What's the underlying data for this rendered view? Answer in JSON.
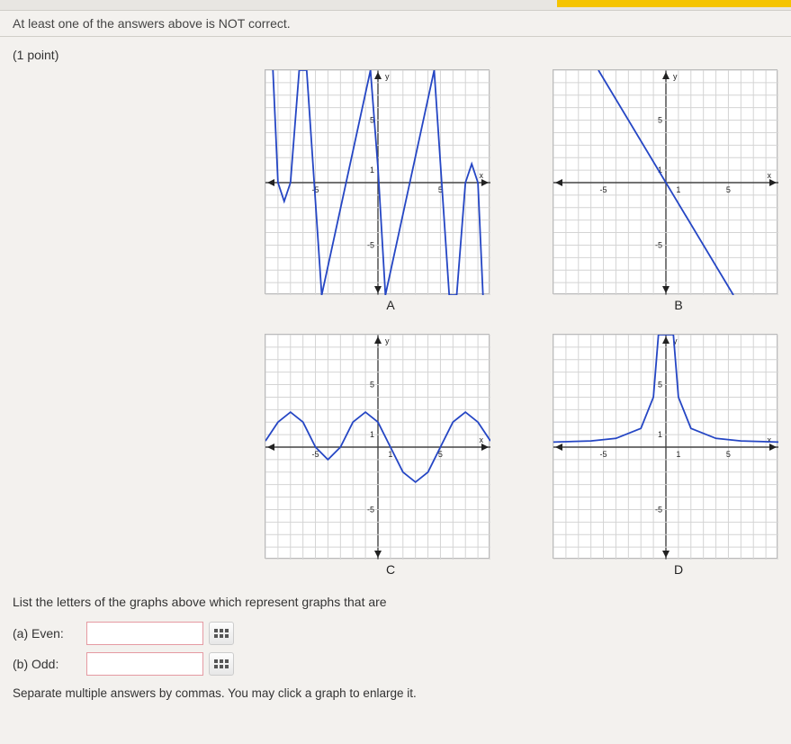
{
  "feedback": "At least one of the answers above is NOT correct.",
  "points": "(1 point)",
  "graphs": {
    "A": {
      "label": "A"
    },
    "B": {
      "label": "B"
    },
    "C": {
      "label": "C"
    },
    "D": {
      "label": "D"
    }
  },
  "prompt": "List the letters of the graphs above which represent graphs that are",
  "answers": {
    "even": {
      "label": "(a) Even:",
      "value": ""
    },
    "odd": {
      "label": "(b) Odd:",
      "value": ""
    }
  },
  "hint": "Separate multiple answers by commas. You may click a graph to enlarge it.",
  "chart_data": [
    {
      "id": "A",
      "type": "line",
      "xlabel": "x",
      "ylabel": "y",
      "xlim": [
        -9,
        9
      ],
      "ylim": [
        -9,
        9
      ],
      "grid": true,
      "ticks": {
        "x": [
          -5,
          5
        ],
        "y": [
          -5,
          1,
          5
        ]
      },
      "description": "odd-symmetric curve (origin symmetry)",
      "points": [
        [
          -8.4,
          9
        ],
        [
          -8,
          0
        ],
        [
          -7.5,
          -1.5
        ],
        [
          -7,
          0
        ],
        [
          -6.3,
          9
        ],
        [
          -5.7,
          9
        ],
        [
          -4.5,
          -9
        ],
        [
          -0.6,
          9
        ],
        [
          0,
          1.2
        ],
        [
          0.6,
          -9
        ],
        [
          4.5,
          9
        ],
        [
          5.7,
          -9
        ],
        [
          6.3,
          -9
        ],
        [
          7,
          0
        ],
        [
          7.5,
          1.5
        ],
        [
          8,
          0
        ],
        [
          8.4,
          -9
        ]
      ]
    },
    {
      "id": "B",
      "type": "line",
      "xlabel": "x",
      "ylabel": "y",
      "xlim": [
        -9,
        9
      ],
      "ylim": [
        -9,
        9
      ],
      "grid": true,
      "ticks": {
        "x": [
          -5,
          1,
          5
        ],
        "y": [
          -5,
          1,
          5
        ]
      },
      "description": "straight line through origin, negative slope (odd)",
      "points": [
        [
          -5.4,
          9
        ],
        [
          5.4,
          -9
        ]
      ]
    },
    {
      "id": "C",
      "type": "line",
      "xlabel": "x",
      "ylabel": "y",
      "xlim": [
        -9,
        9
      ],
      "ylim": [
        -9,
        9
      ],
      "grid": true,
      "ticks": {
        "x": [
          -5,
          1,
          5
        ],
        "y": [
          -5,
          1,
          5
        ]
      },
      "description": "wavy periodic curve, neither even nor odd",
      "points": [
        [
          -9,
          0.5
        ],
        [
          -8,
          2
        ],
        [
          -7,
          2.8
        ],
        [
          -6,
          2
        ],
        [
          -5,
          0
        ],
        [
          -4,
          -1
        ],
        [
          -3,
          0
        ],
        [
          -2,
          2
        ],
        [
          -1,
          2.8
        ],
        [
          0,
          2
        ],
        [
          1,
          0
        ],
        [
          2,
          -2
        ],
        [
          3,
          -2.8
        ],
        [
          4,
          -2
        ],
        [
          5,
          0
        ],
        [
          6,
          2
        ],
        [
          7,
          2.8
        ],
        [
          8,
          2
        ],
        [
          9,
          0.5
        ]
      ]
    },
    {
      "id": "D",
      "type": "line",
      "xlabel": "x",
      "ylabel": "y",
      "xlim": [
        -9,
        9
      ],
      "ylim": [
        -9,
        9
      ],
      "grid": true,
      "ticks": {
        "x": [
          -5,
          1,
          5
        ],
        "y": [
          -5,
          1,
          5
        ]
      },
      "description": "y-axis symmetric spike at x=0 with flat tails (even)",
      "points": [
        [
          -9,
          0.4
        ],
        [
          -6,
          0.5
        ],
        [
          -4,
          0.7
        ],
        [
          -2,
          1.5
        ],
        [
          -1,
          4
        ],
        [
          -0.6,
          9
        ],
        [
          0.6,
          9
        ],
        [
          1,
          4
        ],
        [
          2,
          1.5
        ],
        [
          4,
          0.7
        ],
        [
          6,
          0.5
        ],
        [
          9,
          0.4
        ]
      ]
    }
  ]
}
